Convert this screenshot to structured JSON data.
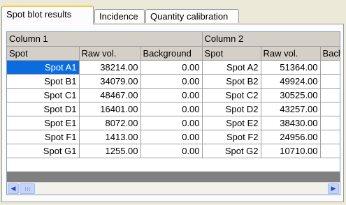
{
  "tabs": [
    {
      "label": "Spot blot results",
      "active": true
    },
    {
      "label": "Incidence",
      "active": false
    },
    {
      "label": "Quantity calibration",
      "active": false
    }
  ],
  "table": {
    "group_headers": [
      "Column 1",
      "Column 2"
    ],
    "column_headers": [
      "Spot",
      "Raw vol.",
      "Background",
      "Spot",
      "Raw vol.",
      "Back"
    ],
    "rows": [
      [
        "Spot A1",
        "38214.00",
        "0.00",
        "Spot A2",
        "51364.00"
      ],
      [
        "Spot B1",
        "34079.00",
        "0.00",
        "Spot B2",
        "49924.00"
      ],
      [
        "Spot C1",
        "48467.00",
        "0.00",
        "Spot C2",
        "30525.00"
      ],
      [
        "Spot D1",
        "16401.00",
        "0.00",
        "Spot D2",
        "43257.00"
      ],
      [
        "Spot E1",
        "8072.00",
        "0.00",
        "Spot E2",
        "38430.00"
      ],
      [
        "Spot F1",
        "1413.00",
        "0.00",
        "Spot F2",
        "24956.00"
      ],
      [
        "Spot G1",
        "1255.00",
        "0.00",
        "Spot G2",
        "10710.00"
      ]
    ],
    "selected_cell": "Spot A1"
  },
  "scrollbar": {
    "left_icon": "arrow-left-icon",
    "right_icon": "arrow-right-icon",
    "left_glyph": "◀",
    "right_glyph": "▶"
  },
  "colors": {
    "selection": "#0a6cde",
    "header": "#d4d0c8",
    "active_tab_accent": "#ffc83c"
  }
}
